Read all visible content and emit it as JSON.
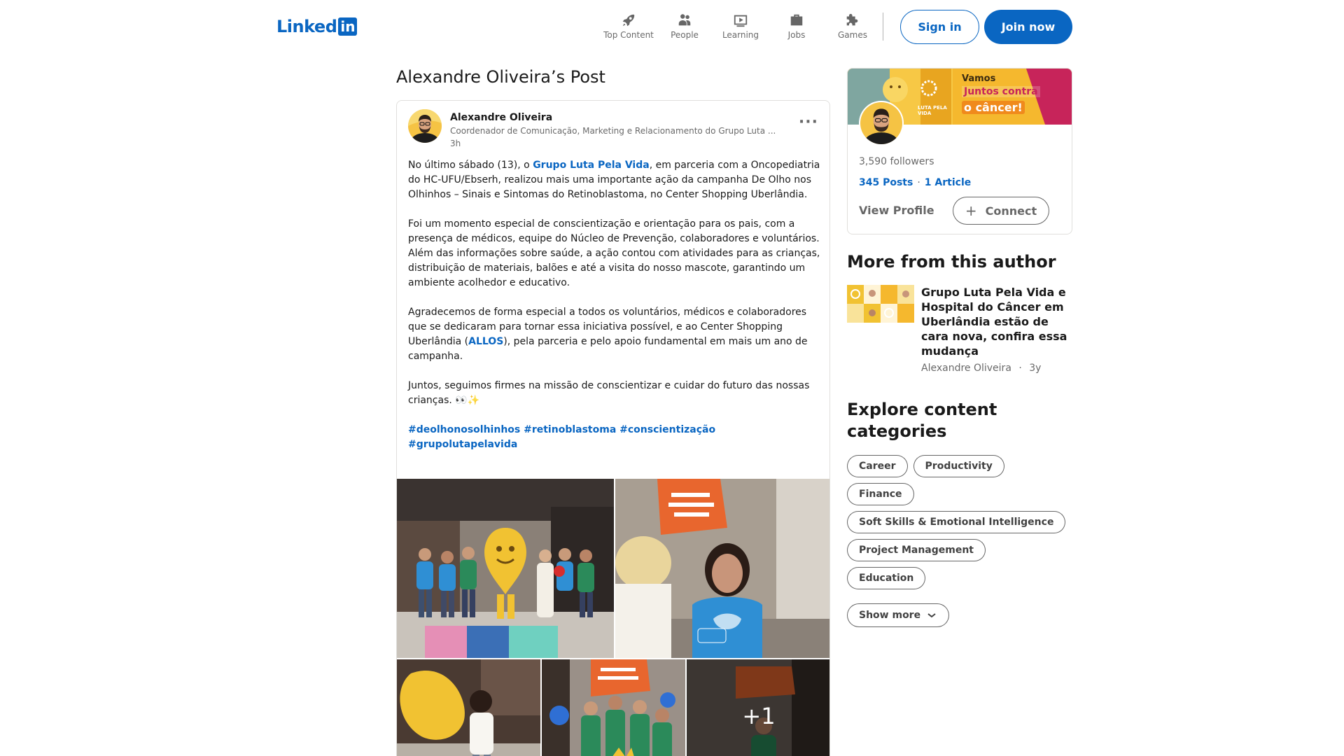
{
  "header": {
    "logo_text": "Linked",
    "logo_box": "in",
    "nav": [
      {
        "label": "Top Content",
        "icon": "rocket-icon"
      },
      {
        "label": "People",
        "icon": "people-icon"
      },
      {
        "label": "Learning",
        "icon": "learning-icon"
      },
      {
        "label": "Jobs",
        "icon": "briefcase-icon"
      },
      {
        "label": "Games",
        "icon": "puzzle-icon"
      }
    ],
    "sign_in": "Sign in",
    "join_now": "Join now"
  },
  "page": {
    "title": "Alexandre Oliveira’s Post"
  },
  "post": {
    "author_name": "Alexandre Oliveira",
    "author_headline": "Coordenador de Comunicação, Marketing e Relacionamento do Grupo Luta ...",
    "time": "3h",
    "more": "···",
    "p1_a": "No último sábado (13), o ",
    "p1_link": "Grupo Luta Pela Vida",
    "p1_b": ", em parceria com a Oncopediatria do HC-UFU/Ebserh, realizou mais uma importante ação da campanha De Olho nos Olhinhos – Sinais e Sintomas do Retinoblastoma, no Center Shopping Uberlândia.",
    "p2": "Foi um momento especial de conscientização e orientação para os pais, com a presença de médicos, equipe do Núcleo de Prevenção, colaboradores e voluntários. Além das informações sobre saúde, a ação contou com atividades para as crianças, distribuição de materiais, balões e até a visita do nosso mascote, garantindo um ambiente acolhedor e educativo.",
    "p3_a": "Agradecemos de forma especial a todos os voluntários, médicos e colaboradores que se dedicaram para tornar essa iniciativa possível, e ao Center Shopping Uberlândia (",
    "p3_link": "ALLOS",
    "p3_b": "), pela parceria e pelo apoio fundamental em mais um ano de campanha.",
    "p4": "Juntos, seguimos firmes na missão de conscientizar e cuidar do futuro das nossas crianças. 👀✨",
    "hashtags": "#deolhonosolhinhos #retinoblastoma #conscientização #grupolutapelavida",
    "extra_photos": "+1"
  },
  "profile": {
    "banner_line1": "Vamos",
    "banner_line2": "Juntos contra",
    "banner_line3": "o câncer!",
    "banner_logo": "LUTA PELA VIDA",
    "followers": "3,590 followers",
    "posts": "345 Posts",
    "articles": "1 Article",
    "view_profile": "View Profile",
    "connect": "Connect"
  },
  "more_from_author": {
    "title": "More from this author",
    "article_title": "Grupo Luta Pela Vida e Hospital do Câncer em Uberlândia estão de cara nova, confira essa mudança",
    "article_author": "Alexandre Oliveira",
    "article_age": "3y"
  },
  "explore": {
    "title": "Explore content categories",
    "rows": [
      [
        "Career",
        "Productivity"
      ],
      [
        "Finance"
      ],
      [
        "Soft Skills & Emotional Intelligence"
      ],
      [
        "Project Management"
      ],
      [
        "Education"
      ]
    ],
    "show_more": "Show more"
  },
  "colors": {
    "brand": "#0a66c2",
    "banner_yellow": "#f5b82e",
    "banner_pink": "#c7245a",
    "shirt_blue": "#2f8fd4",
    "shirt_green": "#2b8a5a"
  }
}
